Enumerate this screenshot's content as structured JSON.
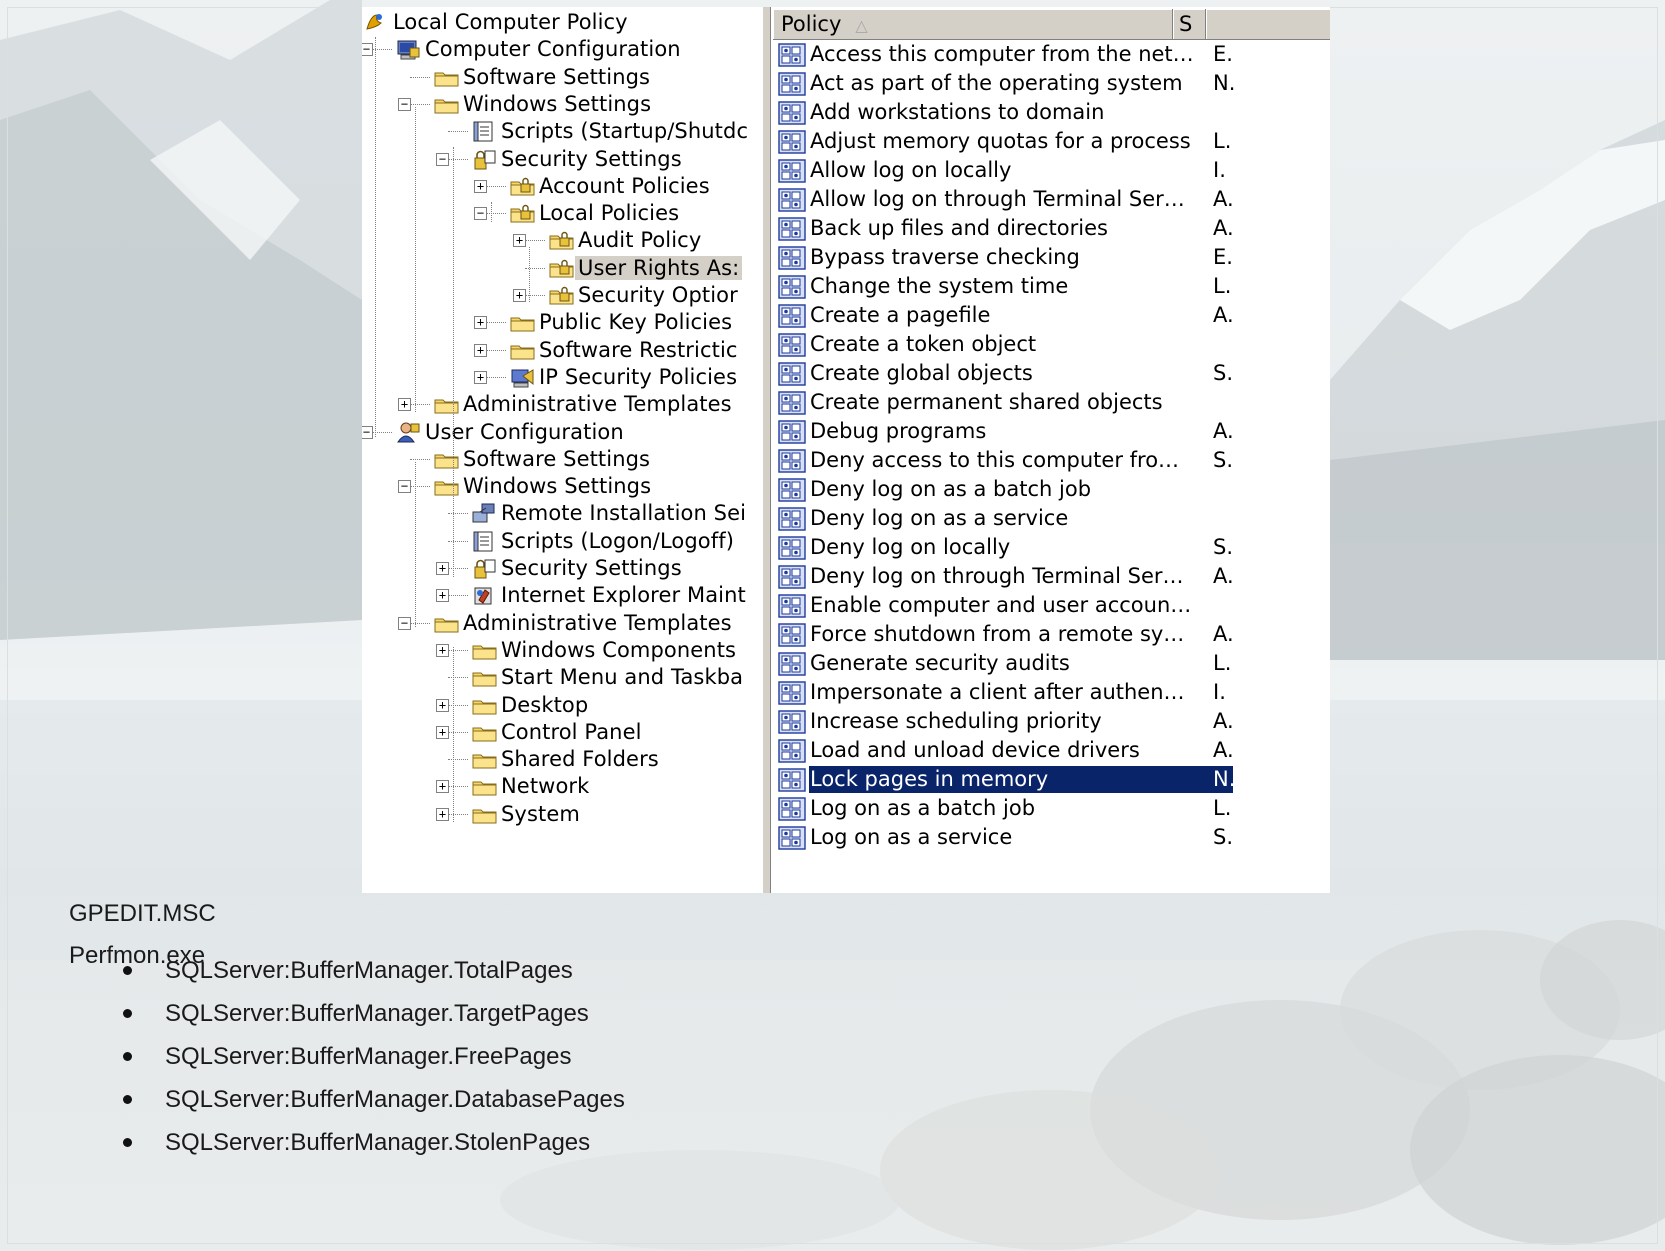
{
  "tree": {
    "nodes": [
      {
        "label": "Local Computer Policy",
        "icon": "policy-icon",
        "indent": 0,
        "expander": ""
      },
      {
        "label": "Computer Configuration",
        "icon": "computer-icon",
        "indent": 1,
        "expander": "-"
      },
      {
        "label": "Software Settings",
        "icon": "folder-icon",
        "indent": 2,
        "expander": ""
      },
      {
        "label": "Windows Settings",
        "icon": "folder-icon",
        "indent": 2,
        "expander": "-"
      },
      {
        "label": "Scripts (Startup/Shutdc",
        "icon": "scripts-icon",
        "indent": 3,
        "expander": ""
      },
      {
        "label": "Security Settings",
        "icon": "security-icon",
        "indent": 3,
        "expander": "-"
      },
      {
        "label": "Account Policies",
        "icon": "lock-folder-icon",
        "indent": 4,
        "expander": "+"
      },
      {
        "label": "Local Policies",
        "icon": "lock-folder-icon",
        "indent": 4,
        "expander": "-"
      },
      {
        "label": "Audit Policy",
        "icon": "lock-folder-icon",
        "indent": 5,
        "expander": "+"
      },
      {
        "label": "User Rights As:",
        "icon": "lock-folder-icon",
        "indent": 5,
        "expander": "",
        "selected": true
      },
      {
        "label": "Security Optior",
        "icon": "lock-folder-icon",
        "indent": 5,
        "expander": "+"
      },
      {
        "label": "Public Key Policies",
        "icon": "folder-icon",
        "indent": 4,
        "expander": "+"
      },
      {
        "label": "Software Restrictic",
        "icon": "folder-icon",
        "indent": 4,
        "expander": "+"
      },
      {
        "label": "IP Security Policies",
        "icon": "ipsec-icon",
        "indent": 4,
        "expander": "+"
      },
      {
        "label": "Administrative Templates",
        "icon": "folder-icon",
        "indent": 2,
        "expander": "+"
      },
      {
        "label": "User Configuration",
        "icon": "user-icon",
        "indent": 1,
        "expander": "-"
      },
      {
        "label": "Software Settings",
        "icon": "folder-icon",
        "indent": 2,
        "expander": ""
      },
      {
        "label": "Windows Settings",
        "icon": "folder-icon",
        "indent": 2,
        "expander": "-"
      },
      {
        "label": "Remote Installation Sei",
        "icon": "remote-install-icon",
        "indent": 3,
        "expander": ""
      },
      {
        "label": "Scripts (Logon/Logoff)",
        "icon": "scripts-icon",
        "indent": 3,
        "expander": ""
      },
      {
        "label": "Security Settings",
        "icon": "security-icon",
        "indent": 3,
        "expander": "+"
      },
      {
        "label": "Internet Explorer Maint",
        "icon": "ie-maintenance-icon",
        "indent": 3,
        "expander": "+"
      },
      {
        "label": "Administrative Templates",
        "icon": "folder-icon",
        "indent": 2,
        "expander": "-"
      },
      {
        "label": "Windows Components",
        "icon": "folder-icon",
        "indent": 3,
        "expander": "+"
      },
      {
        "label": "Start Menu and Taskba",
        "icon": "folder-icon",
        "indent": 3,
        "expander": ""
      },
      {
        "label": "Desktop",
        "icon": "folder-icon",
        "indent": 3,
        "expander": "+"
      },
      {
        "label": "Control Panel",
        "icon": "folder-icon",
        "indent": 3,
        "expander": "+"
      },
      {
        "label": "Shared Folders",
        "icon": "folder-icon",
        "indent": 3,
        "expander": ""
      },
      {
        "label": "Network",
        "icon": "folder-icon",
        "indent": 3,
        "expander": "+"
      },
      {
        "label": "System",
        "icon": "folder-icon",
        "indent": 3,
        "expander": "+"
      }
    ]
  },
  "list": {
    "header": {
      "policy": "Policy",
      "sort_glyph": "△",
      "setting": "S"
    },
    "rows": [
      {
        "policy": "Access this computer from the net…",
        "setting": "E."
      },
      {
        "policy": "Act as part of the operating system",
        "setting": "N."
      },
      {
        "policy": "Add workstations to domain",
        "setting": ""
      },
      {
        "policy": "Adjust memory quotas for a process",
        "setting": "L."
      },
      {
        "policy": "Allow log on locally",
        "setting": "I."
      },
      {
        "policy": "Allow log on through Terminal Ser…",
        "setting": "A."
      },
      {
        "policy": "Back up files and directories",
        "setting": "A."
      },
      {
        "policy": "Bypass traverse checking",
        "setting": "E."
      },
      {
        "policy": "Change the system time",
        "setting": "L."
      },
      {
        "policy": "Create a pagefile",
        "setting": "A."
      },
      {
        "policy": "Create a token object",
        "setting": ""
      },
      {
        "policy": "Create global objects",
        "setting": "S."
      },
      {
        "policy": "Create permanent shared objects",
        "setting": ""
      },
      {
        "policy": "Debug programs",
        "setting": "A."
      },
      {
        "policy": "Deny access to this computer fro…",
        "setting": "S."
      },
      {
        "policy": "Deny log on as a batch job",
        "setting": ""
      },
      {
        "policy": "Deny log on as a service",
        "setting": ""
      },
      {
        "policy": "Deny log on locally",
        "setting": "S."
      },
      {
        "policy": "Deny log on through Terminal Ser…",
        "setting": "A."
      },
      {
        "policy": "Enable computer and user accoun…",
        "setting": ""
      },
      {
        "policy": "Force shutdown from a remote sy…",
        "setting": "A."
      },
      {
        "policy": "Generate security audits",
        "setting": "L."
      },
      {
        "policy": "Impersonate a client after authen…",
        "setting": "I."
      },
      {
        "policy": "Increase scheduling priority",
        "setting": "A."
      },
      {
        "policy": "Load and unload device drivers",
        "setting": "A."
      },
      {
        "policy": "Lock pages in memory",
        "setting": "N.",
        "selected": true
      },
      {
        "policy": "Log on as a batch job",
        "setting": "L."
      },
      {
        "policy": "Log on as a service",
        "setting": "S."
      }
    ],
    "row_icon": "policy-setting-icon"
  },
  "slide": {
    "caption1": "GPEDIT.MSC",
    "caption2": "Perfmon.exe",
    "bullets": [
      "SQLServer:BufferManager.TotalPages",
      "SQLServer:BufferManager.TargetPages",
      "SQLServer:BufferManager.FreePages",
      "SQLServer:BufferManager.DatabasePages",
      "SQLServer:BufferManager.StolenPages"
    ]
  },
  "colors": {
    "selection": "#0a246a",
    "folder": "#f6d66a",
    "chrome": "#d4d0c8"
  }
}
